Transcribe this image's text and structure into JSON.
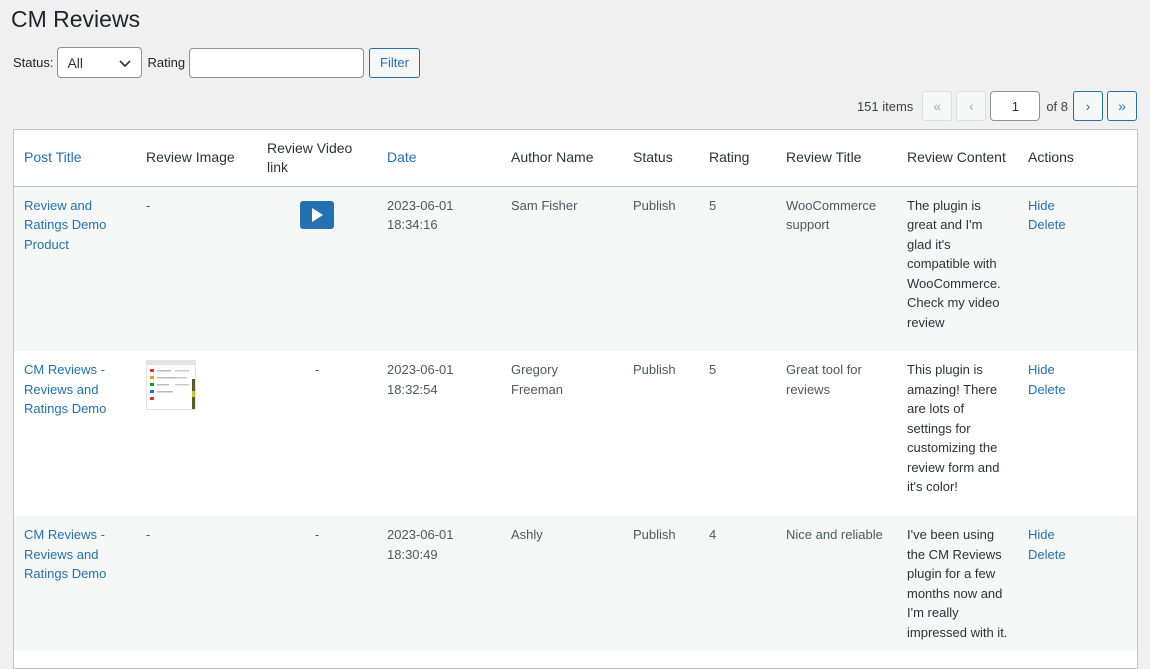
{
  "page": {
    "title": "CM Reviews"
  },
  "filters": {
    "status_label": "Status:",
    "status_value": "All",
    "rating_label": "Rating",
    "rating_value": "",
    "filter_button": "Filter"
  },
  "pagination": {
    "items_count": "151 items",
    "first": "«",
    "prev": "‹",
    "current_page": "1",
    "of_label": "of 8",
    "next": "›",
    "last": "»"
  },
  "table": {
    "columns": [
      "Post Title",
      "Review Image",
      "Review Video link",
      "Date",
      "Author Name",
      "Status",
      "Rating",
      "Review Title",
      "Review Content",
      "Actions"
    ],
    "rows": [
      {
        "post_title": "Review and Ratings Demo Product",
        "review_image": "-",
        "review_video": "",
        "date": "2023-06-01 18:34:16",
        "author": "Sam Fisher",
        "status": "Publish",
        "rating": "5",
        "review_title": "WooCommerce support",
        "review_content": "The plugin is great and I'm glad it's compatible with WooCommerce. Check my video review",
        "action_hide": "Hide",
        "action_delete": "Delete"
      },
      {
        "post_title": "CM Reviews - Reviews and Ratings Demo",
        "review_image": "",
        "review_video": "-",
        "date": "2023-06-01 18:32:54",
        "author": "Gregory Freeman",
        "status": "Publish",
        "rating": "5",
        "review_title": "Great tool for reviews",
        "review_content": "This plugin is amazing! There are lots of settings for customizing the review form and it's color!",
        "action_hide": "Hide",
        "action_delete": "Delete"
      },
      {
        "post_title": "CM Reviews - Reviews and Ratings Demo",
        "review_image": "-",
        "review_video": "-",
        "date": "2023-06-01 18:30:49",
        "author": "Ashly",
        "status": "Publish",
        "rating": "4",
        "review_title": "Nice and reliable",
        "review_content": "I've been using the CM Reviews plugin for a few months now and I'm really impressed with it.",
        "action_hide": "Hide",
        "action_delete": "Delete"
      }
    ]
  },
  "icons": {
    "status_dropdown": "chevron-down-icon",
    "video": "play-icon",
    "image": "image-thumbnail"
  },
  "colors": {
    "accent": "#2271b1",
    "background": "#f0f0f1"
  }
}
